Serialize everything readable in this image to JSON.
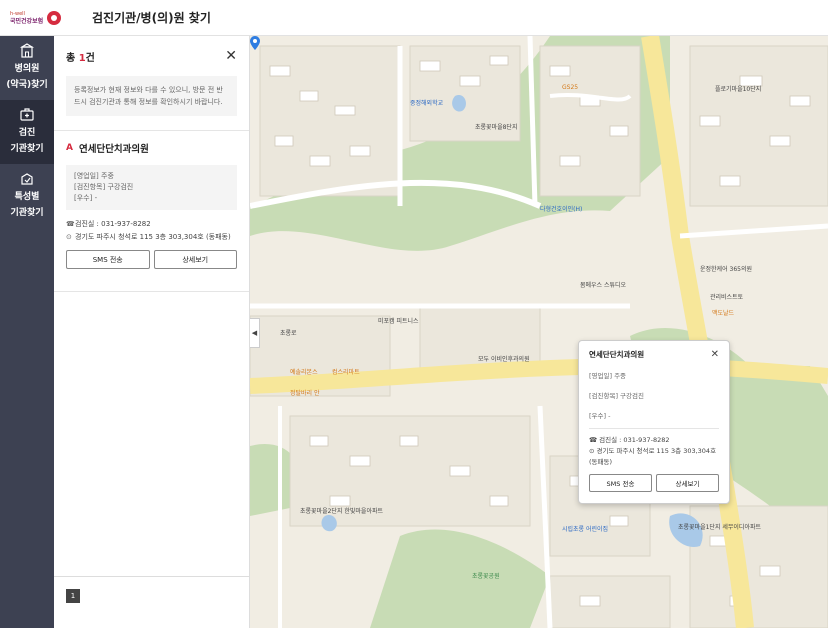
{
  "header": {
    "logo_brand": "h-well",
    "logo_name": "국민건강보험",
    "page_title": "검진기관/병(의)원 찾기"
  },
  "nav": {
    "items": [
      {
        "label_line1": "병의원",
        "label_line2": "(약국)찾기",
        "icon": "hospital-icon"
      },
      {
        "label_line1": "검진",
        "label_line2": "기관찾기",
        "icon": "checkup-icon"
      },
      {
        "label_line1": "특성별",
        "label_line2": "기관찾기",
        "icon": "special-icon"
      }
    ]
  },
  "panel": {
    "total_prefix": "총 ",
    "total_count": "1",
    "total_suffix": "건",
    "notice": "등록정보가 현재 정보와 다를 수 있으니, 방문 전 반드시 검진기관과 통해 정보를 확인하시기 바랍니다.",
    "result": {
      "marker": "A",
      "name": "연세단단치과의원",
      "business_type": "[영업일] 주중",
      "checkup_items": "[검진항목] 구강검진",
      "excellence": "[우수] -",
      "phone_label": "검진실 : 031-937-8282",
      "address": "경기도 파주시 청석로 115 3층 303,304호 (동패동)",
      "sms_button": "SMS 전송",
      "detail_button": "상세보기"
    },
    "page_number": "1"
  },
  "popup": {
    "name": "연세단단치과의원",
    "business_type": "[영업일] 주중",
    "checkup_items": "[검진항목] 구강검진",
    "excellence": "[우수] -",
    "phone_label": "검진실 : 031-937-8282",
    "address": "경기도 파주시 청석로 115 3층 303,304호 (동패동)",
    "sms_button": "SMS 전송",
    "detail_button": "상세보기"
  },
  "map": {
    "labels": [
      {
        "text": "중정해외학교",
        "color": "blue"
      },
      {
        "text": "다형건호이인(H)",
        "color": "blue"
      },
      {
        "text": "초롱꽃마을8단지",
        "color": "default"
      },
      {
        "text": "플로기마을10단지",
        "color": "default"
      },
      {
        "text": "봄메우스 스튜디오",
        "color": "default"
      },
      {
        "text": "운정한케어 365의원",
        "color": "default"
      },
      {
        "text": "관리비스트토",
        "color": "default"
      },
      {
        "text": "맥도날드",
        "color": "orange"
      },
      {
        "text": "미포캠 피트니스",
        "color": "default"
      },
      {
        "text": "모두 이비인후과의원",
        "color": "default"
      },
      {
        "text": "예솔리본스",
        "color": "orange"
      },
      {
        "text": "컴스리마트",
        "color": "orange"
      },
      {
        "text": "정탈바리 안",
        "color": "orange"
      },
      {
        "text": "초롱꽃마을2단지 한빛마을아파트",
        "color": "default"
      },
      {
        "text": "초롱꽃마을1단지 세무이디아파트",
        "color": "default"
      },
      {
        "text": "시립초롱 어린이집",
        "color": "blue"
      },
      {
        "text": "초롱꽃공원",
        "color": "green"
      },
      {
        "text": "초롱로",
        "color": "default"
      },
      {
        "text": "GS25",
        "color": "orange"
      }
    ]
  },
  "colors": {
    "nav_bg": "#3d4152",
    "accent_red": "#d52b3f",
    "map_road_yellow": "#f7e79a",
    "map_park_green": "#c8dcb5"
  }
}
